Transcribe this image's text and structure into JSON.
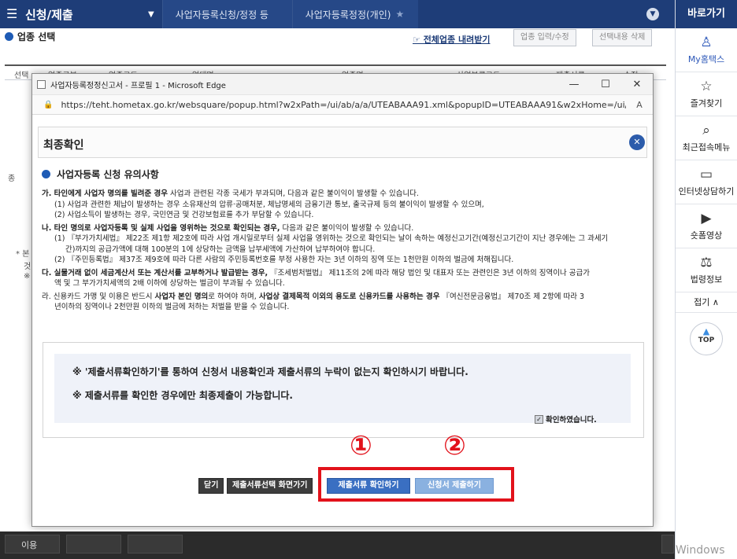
{
  "header": {
    "menu_icon": "☰",
    "title": "신청/제출",
    "caret": "▼",
    "breadcrumb": [
      "사업자등록신청/정정 등",
      "사업자등록정정(개인)"
    ],
    "star": "★",
    "collapse": "▼"
  },
  "quick_panel": {
    "title": "바로가기",
    "items": [
      {
        "label": "My홈택스",
        "icon": "user-icon",
        "glyph": "♙"
      },
      {
        "label": "즐겨찾기",
        "icon": "star-icon",
        "glyph": "☆"
      },
      {
        "label": "최근접속메뉴",
        "icon": "search-doc-icon",
        "glyph": "⌕"
      },
      {
        "label": "인터넷상담하기",
        "icon": "monitor-icon",
        "glyph": "▭"
      },
      {
        "label": "숏폼영상",
        "icon": "play-icon",
        "glyph": "▶"
      },
      {
        "label": "법령정보",
        "icon": "gavel-icon",
        "glyph": "⚖"
      }
    ],
    "fold_label": "접기 ∧",
    "top_label": "TOP",
    "top_arrow": "▲"
  },
  "background": {
    "section_title": "업종 선택",
    "all_industry_link": "☞ 전체업종 내려받기",
    "btn_input_edit": "업종 입력/수정",
    "btn_delete": "선택내용 삭제",
    "table_headers": [
      "선택",
      "업종구분",
      "업종코드",
      "업태명",
      "업종명",
      "산업분류코드",
      "제출서류",
      "수정"
    ],
    "left_fragments": [
      "종",
      "* 본",
      "것",
      "※",
      "이용"
    ]
  },
  "popup": {
    "window_title": "사업자등록정정신고서 - 프로필 1 - Microsoft Edge",
    "window_controls": [
      "—",
      "☐",
      "✕"
    ],
    "lock": "🔒",
    "url": "https://teht.hometax.go.kr/websquare/popup.html?w2xPath=/ui/ab/a/a/UTEABAAA91.xml&popupID=UTEABAAA91&w2xHome=/ui/ab/a/a/&w2x...",
    "reader_icon": "A",
    "modal_title": "최종확인",
    "modal_close": "✕",
    "notice_title": "사업자등록 신청 유의사항",
    "notice": {
      "ga_bold": "가. 타인에게 사업자 명의를 빌려준 경우",
      "ga_rest": " 사업과 관련된 각종 국세가 부과되며, 다음과 같은 불이익이 발생할 수 있습니다.",
      "ga_1": "(1) 사업과 관련한 체납이 발생하는 경우 소유재산의 압류·공매처분, 체납명세의 금융기관 통보, 출국규제 등의 불이익이 발생할 수 있으며,",
      "ga_2": "(2) 사업소득이 발생하는 경우, 국민연금 및 건강보험료를 추가 부담할 수 있습니다.",
      "na_bold": "나. 타인 명의로 사업자등록 및 실제 사업을 영위하는 것으로 확인되는 경우,",
      "na_rest": " 다음과 같은 불이익이 발생할 수 있습니다.",
      "na_1a": "(1) 『부가가치세법』 제22조 제1항 제2호에 따라 사업 개시일로부터 실제 사업을 영위하는 것으로 확인되는 날이 속하는 예정신고기간(예정신고기간이 지난 경우에는 그 과세기",
      "na_1b": "간)까지의 공급가액에 대해 100분의 1에 상당하는 금액을 납부세액에 가산하여 납부하여야 합니다.",
      "na_2": "(2) 『주민등록법』 제37조 제9호에 따라 다른 사람의 주민등록번호를 부정 사용한 자는 3년 이하의 징역 또는 1천만원 이하의 벌금에 처해집니다.",
      "da_bold": "다. 실물거래 없이 세금계산서 또는 계산서를 교부하거나 발급받는 경우,",
      "da_rest": " 『조세범처벌법』 제11조의 2에 따라 해당 법인 및 대표자 또는 관련인은 3년 이하의 징역이나 공급가",
      "da_2": "액 및 그 부가가치세액의 2배 이하에 상당하는 벌금이 부과될 수 있습니다.",
      "ra_1": "라. 신용카드 가맹 및 이용은 반드시 ",
      "ra_bold1": "사업자 본인 명의",
      "ra_2": "로 하여야 하며, ",
      "ra_bold2": "사업상 결제목적 이외의 용도로 신용카드를 사용하는 경우",
      "ra_3": " 『여신전문금융법』 제70조 제 2항에 따라 3",
      "ra_4": "년이하의 징역이나 2천만원 이하의 벌금에 처하는 처벌을 받을 수 있습니다."
    },
    "confirm_line1": "※  '제출서류확인하기'를 통하여 신청서 내용확인과 제출서류의 누락이 없는지 확인하시기 바랍니다.",
    "confirm_line2": "※  제출서류를 확인한 경우에만 최종제출이 가능합니다.",
    "confirm_check_label": "확인하였습니다.",
    "buttons": {
      "close": "닫기",
      "doc_select": "제출서류선택 화면가기",
      "check_docs": "제출서류 확인하기",
      "submit": "신청서 제출하기"
    },
    "annotations": [
      "①",
      "②"
    ]
  },
  "taskbar": {
    "first_item": "이용",
    "watermark": "Windows"
  },
  "colors": {
    "header_navy": "#1e3d78",
    "accent_blue": "#3a6fc2",
    "annotation_red": "#e2121b"
  }
}
